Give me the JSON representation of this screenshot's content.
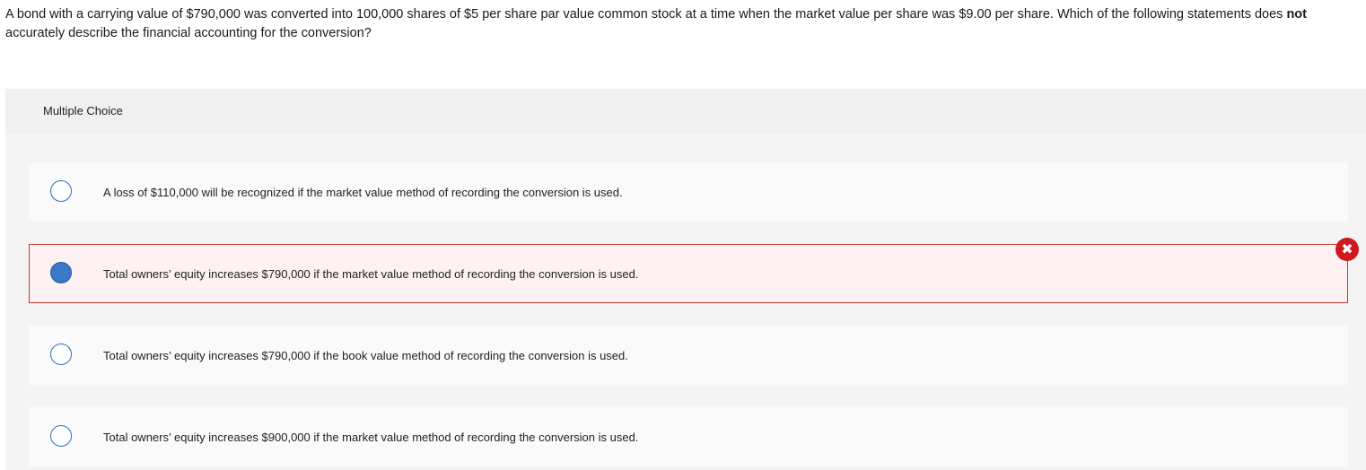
{
  "question": {
    "text_before_bold": "A bond with a carrying value of $790,000 was converted into 100,000 shares of $5 per share par value common stock at a time when the market value per share was $9.00 per share. Which of the following statements does ",
    "bold_word": "not",
    "text_after_bold": " accurately describe the financial accounting for the conversion?"
  },
  "multiple_choice": {
    "label": "Multiple Choice",
    "options": [
      {
        "text": "A loss of $110,000 will be recognized if the market value method of recording the conversion is used.",
        "selected": false
      },
      {
        "text": "Total owners’ equity increases $790,000 if the market value method of recording the conversion is used.",
        "selected": true,
        "status": "incorrect"
      },
      {
        "text": "Total owners’ equity increases $790,000 if the book value method of recording the conversion is used.",
        "selected": false
      },
      {
        "text": "Total owners’ equity increases $900,000 if the market value method of recording the conversion is used.",
        "selected": false
      }
    ]
  },
  "icons": {
    "incorrect_marker": "close-circle-icon",
    "incorrect_glyph": "✖"
  },
  "colors": {
    "selected_border": "#c0392b",
    "selected_bg": "#fdf1f1",
    "radio_fill": "#3a79c8",
    "incorrect_icon": "#d0191f"
  }
}
